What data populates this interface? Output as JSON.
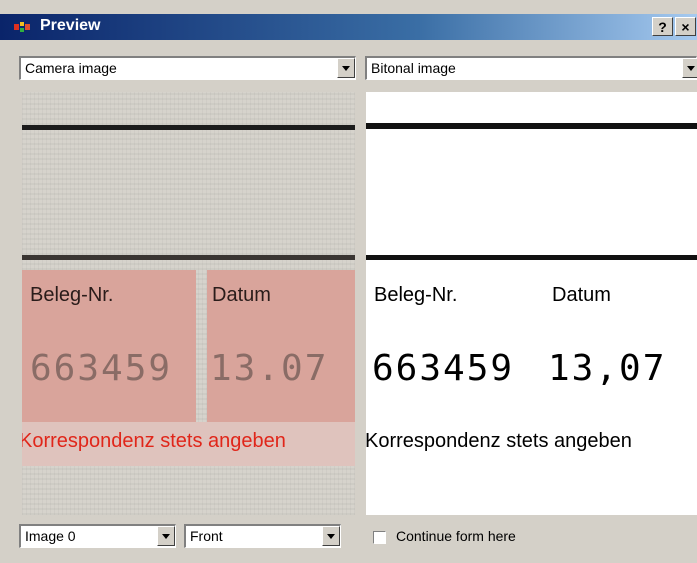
{
  "window": {
    "title": "Preview",
    "help_button": "?",
    "close_button": "×"
  },
  "left_view": {
    "selected": "Camera image"
  },
  "right_view": {
    "selected": "Bitonal image"
  },
  "document": {
    "label_beleg": "Beleg-Nr.",
    "label_datum": "Datum",
    "beleg_value": "663459",
    "datum_value": "13.07",
    "datum_value_bitonal": "13,07",
    "footer_text": "Korrespondenz stets angeben"
  },
  "footer": {
    "image_select": "Image 0",
    "side_select": "Front",
    "continue_label": "Continue form here",
    "continue_checked": false
  },
  "colors": {
    "title_gradient_start": "#0a246a",
    "camera_pink": "#d9a49b",
    "camera_red_text": "#e0261a"
  }
}
